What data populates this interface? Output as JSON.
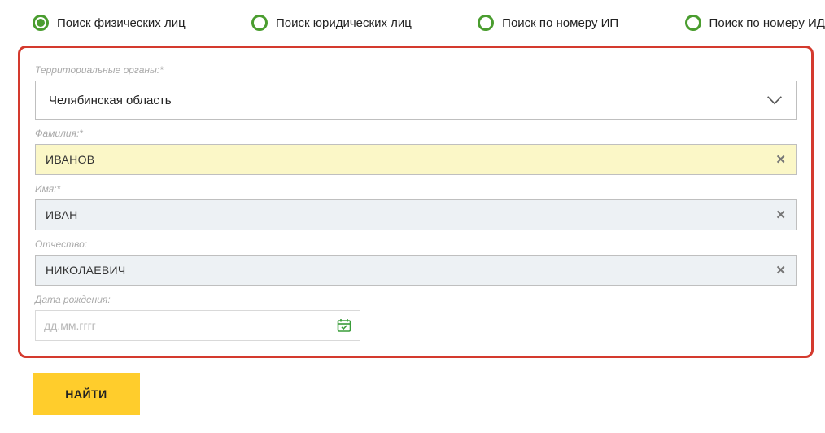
{
  "tabs": [
    {
      "label": "Поиск физических лиц",
      "selected": true
    },
    {
      "label": "Поиск юридических лиц",
      "selected": false
    },
    {
      "label": "Поиск по номеру ИП",
      "selected": false
    },
    {
      "label": "Поиск по номеру ИД",
      "selected": false
    }
  ],
  "form": {
    "territory": {
      "label": "Территориальные органы:*",
      "value": "Челябинская область"
    },
    "lastname": {
      "label": "Фамилия:*",
      "value": "ИВАНОВ"
    },
    "firstname": {
      "label": "Имя:*",
      "value": "ИВАН"
    },
    "patronymic": {
      "label": "Отчество:",
      "value": "НИКОЛАЕВИЧ"
    },
    "birthdate": {
      "label": "Дата рождения:",
      "placeholder": "дд.мм.гггг"
    }
  },
  "submit_label": "НАЙТИ"
}
